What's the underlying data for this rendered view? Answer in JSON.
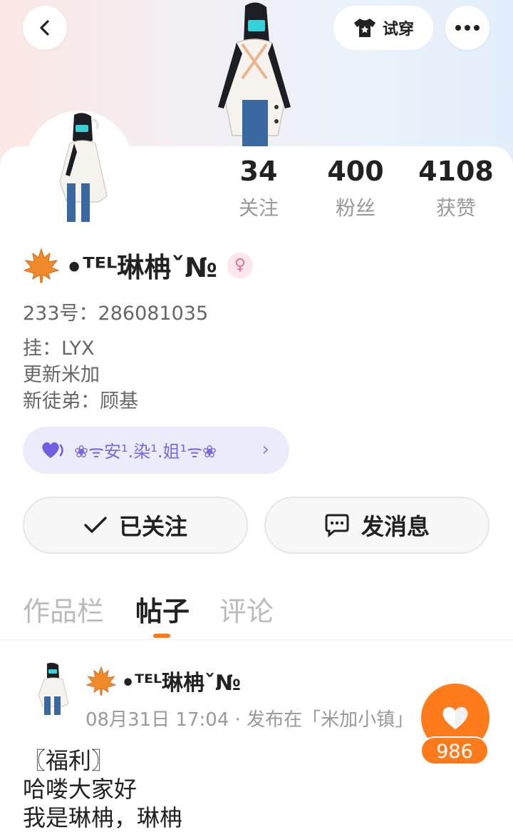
{
  "header": {
    "try_on_label": "试穿",
    "icons": {
      "back": "chevron-left-icon",
      "try_on": "tshirt-icon",
      "more": "more-dots-icon"
    }
  },
  "stats": [
    {
      "value": "34",
      "label": "关注"
    },
    {
      "value": "400",
      "label": "粉丝"
    },
    {
      "value": "4108",
      "label": "获赞"
    }
  ],
  "profile": {
    "name": "•ᵀᴱᴸ琳柟ˇ№",
    "gender": "female",
    "uid": "233号：286081035",
    "bio": [
      "挂：LYX",
      "更新米加",
      "新徒弟：顾基"
    ],
    "tag_text": "❀ᯤ安¹.染¹.姐¹ᯤ❀"
  },
  "actions": {
    "follow_label": "已关注",
    "message_label": "发消息"
  },
  "tabs": [
    {
      "label": "作品栏",
      "active": false
    },
    {
      "label": "帖子",
      "active": true
    },
    {
      "label": "评论",
      "active": false
    }
  ],
  "post": {
    "author": "•ᵀᴱᴸ琳柟ˇ№",
    "meta": "08月31日 17:04 · 发布在「米加小镇」",
    "body": "〖福利〗\n哈喽大家好\n我是琳柟，琳柟",
    "likes": "986"
  },
  "colors": {
    "accent": "#ff7a1a",
    "tag_bg": "#ecebfc",
    "tag_text": "#7a6ae0",
    "gender_bg": "#fde6ee",
    "gender_fg": "#ef6b95"
  }
}
